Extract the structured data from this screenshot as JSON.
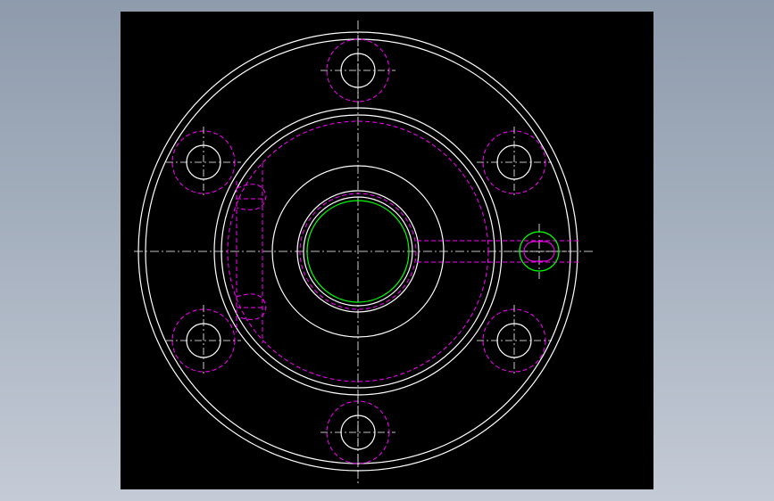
{
  "drawing": {
    "background": "#000000",
    "colors": {
      "outline": "#ffffff",
      "hidden": "#ff00ff",
      "accent": "#00ff00",
      "centerline": "#ffffff"
    },
    "line_styles": {
      "outline": "continuous",
      "hidden": "dashed",
      "centerline": "dash-dot"
    },
    "features": {
      "bolt_holes": 6,
      "outer_rings": 2,
      "hub_rings": 2,
      "bore_rings": 3,
      "side_port": 1
    }
  }
}
